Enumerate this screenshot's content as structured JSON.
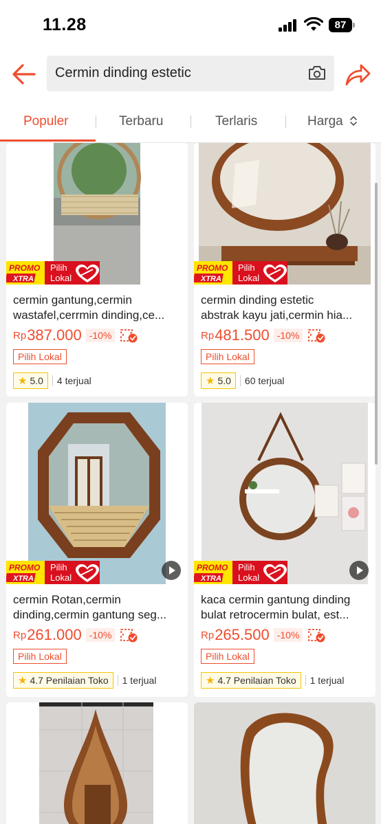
{
  "status_bar": {
    "time": "11.28",
    "battery": "87"
  },
  "search": {
    "query": "Cermin dinding estetic"
  },
  "sort_tabs": [
    {
      "label": "Populer"
    },
    {
      "label": "Terbaru"
    },
    {
      "label": "Terlaris"
    },
    {
      "label": "Harga"
    }
  ],
  "badges": {
    "promo_line1": "PROMO",
    "promo_line2": "XTRA",
    "local_line1": "Pilih",
    "local_line2": "Lokal"
  },
  "products": [
    {
      "title_line1": "cermin gantung,cermin",
      "title_line2": "wastafel,cerrmin dinding,ce...",
      "currency": "Rp",
      "price": "387.000",
      "discount": "-10%",
      "tag": "Pilih Lokal",
      "rating": "5.0",
      "sold": "4 terjual"
    },
    {
      "title_line1": "cermin dinding estetic",
      "title_line2": "abstrak kayu jati,cermin hia...",
      "currency": "Rp",
      "price": "481.500",
      "discount": "-10%",
      "tag": "Pilih Lokal",
      "rating": "5.0",
      "sold": "60 terjual"
    },
    {
      "title_line1": "cermin Rotan,cermin",
      "title_line2": "dinding,cermin gantung seg...",
      "currency": "Rp",
      "price": "261.000",
      "discount": "-10%",
      "tag": "Pilih Lokal",
      "rating": "4.7 Penilaian Toko",
      "sold": "1 terjual"
    },
    {
      "title_line1": "kaca cermin gantung dinding",
      "title_line2": "bulat retrocermin bulat, est...",
      "currency": "Rp",
      "price": "265.500",
      "discount": "-10%",
      "tag": "Pilih Lokal",
      "rating": "4.7 Penilaian Toko",
      "sold": "1 terjual"
    }
  ],
  "colors": {
    "accent": "#ee4d2d",
    "rating_border": "#f5c400"
  }
}
